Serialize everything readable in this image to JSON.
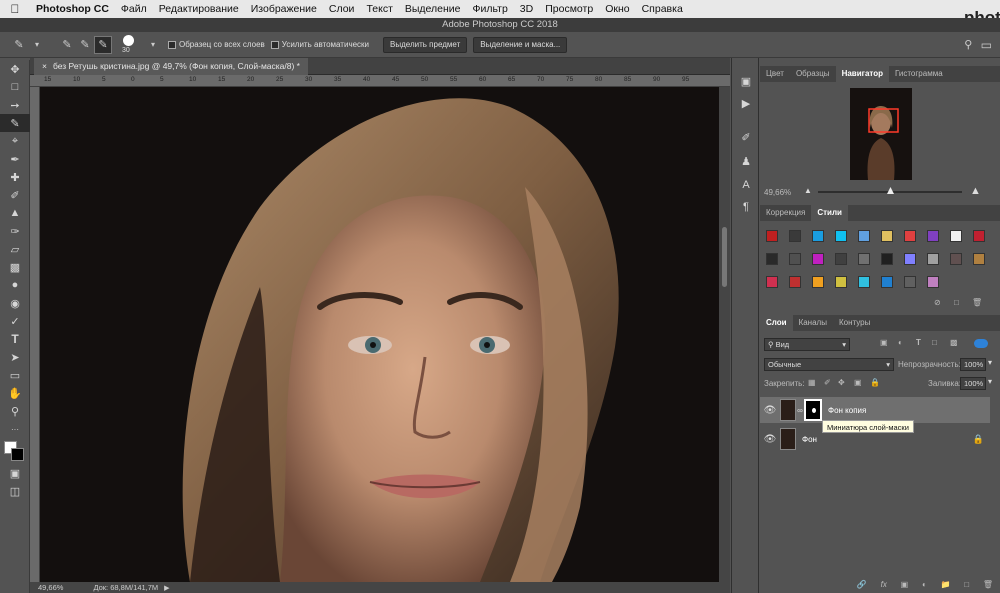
{
  "menubar": {
    "app": "Photoshop CC",
    "items": [
      "Файл",
      "Редактирование",
      "Изображение",
      "Слои",
      "Текст",
      "Выделение",
      "Фильтр",
      "3D",
      "Просмотр",
      "Окно",
      "Справка"
    ]
  },
  "window": {
    "title": "Adobe Photoshop CC 2018"
  },
  "options": {
    "brush_size": "30",
    "sample_all_layers": "Образец со всех слоев",
    "auto_enhance": "Усилить автоматически",
    "select_subject": "Выделить предмет",
    "select_and_mask": "Выделение и маска..."
  },
  "document": {
    "tab_title": "без Ретушь кристина.jpg @ 49,7% (Фон копия, Слой-маска/8) *",
    "ruler_ticks": [
      "15",
      "10",
      "5",
      "0",
      "5",
      "10",
      "15",
      "20",
      "25",
      "30",
      "35",
      "40",
      "45",
      "50",
      "55",
      "60",
      "65",
      "70",
      "75",
      "80",
      "85",
      "90",
      "95"
    ]
  },
  "status": {
    "zoom": "49,66%",
    "doc": "Док: 68,8M/141,7M"
  },
  "navigator": {
    "tabs": [
      "Цвет",
      "Образцы",
      "Навигатор",
      "Гистограмма"
    ],
    "active": "Навигатор",
    "zoom": "49,66%",
    "zoom_level": 0.5
  },
  "styles": {
    "tabs": [
      "Коррекция",
      "Стили"
    ],
    "active": "Стили",
    "swatch_colors": [
      "#c02020",
      "#3a3a3a",
      "#1a9de0",
      "#10c0f0",
      "#60a0e0",
      "#e0c060",
      "#e04040",
      "#8040c0",
      "#f0f0f0",
      "#c02030",
      "#2a2a2a",
      "#505050",
      "#c020c0",
      "#404040",
      "#707070",
      "#202020",
      "#8080ff",
      "#a0a0a0",
      "#605050",
      "#b08040",
      "#d03050",
      "#c03030",
      "#f0a020",
      "#d0c040",
      "#30c0e0",
      "#2080d0",
      "#606060",
      "#c080c0"
    ]
  },
  "layers": {
    "tabs": [
      "Слои",
      "Каналы",
      "Контуры"
    ],
    "active": "Слои",
    "filter": "Вид",
    "blend_mode": "Обычные",
    "opacity_label": "Непрозрачность:",
    "opacity": "100%",
    "lock_label": "Закрепить:",
    "fill_label": "Заливка:",
    "fill": "100%",
    "items": [
      {
        "name": "Фон копия",
        "selected": true
      },
      {
        "name": "Фон",
        "selected": false
      }
    ],
    "tooltip": "Миниатюра слой-маски"
  },
  "logo": {
    "text": "phot ex"
  },
  "colors": {
    "accent": "#2e82d8",
    "panel": "#535353",
    "dark": "#3a3a3a"
  }
}
